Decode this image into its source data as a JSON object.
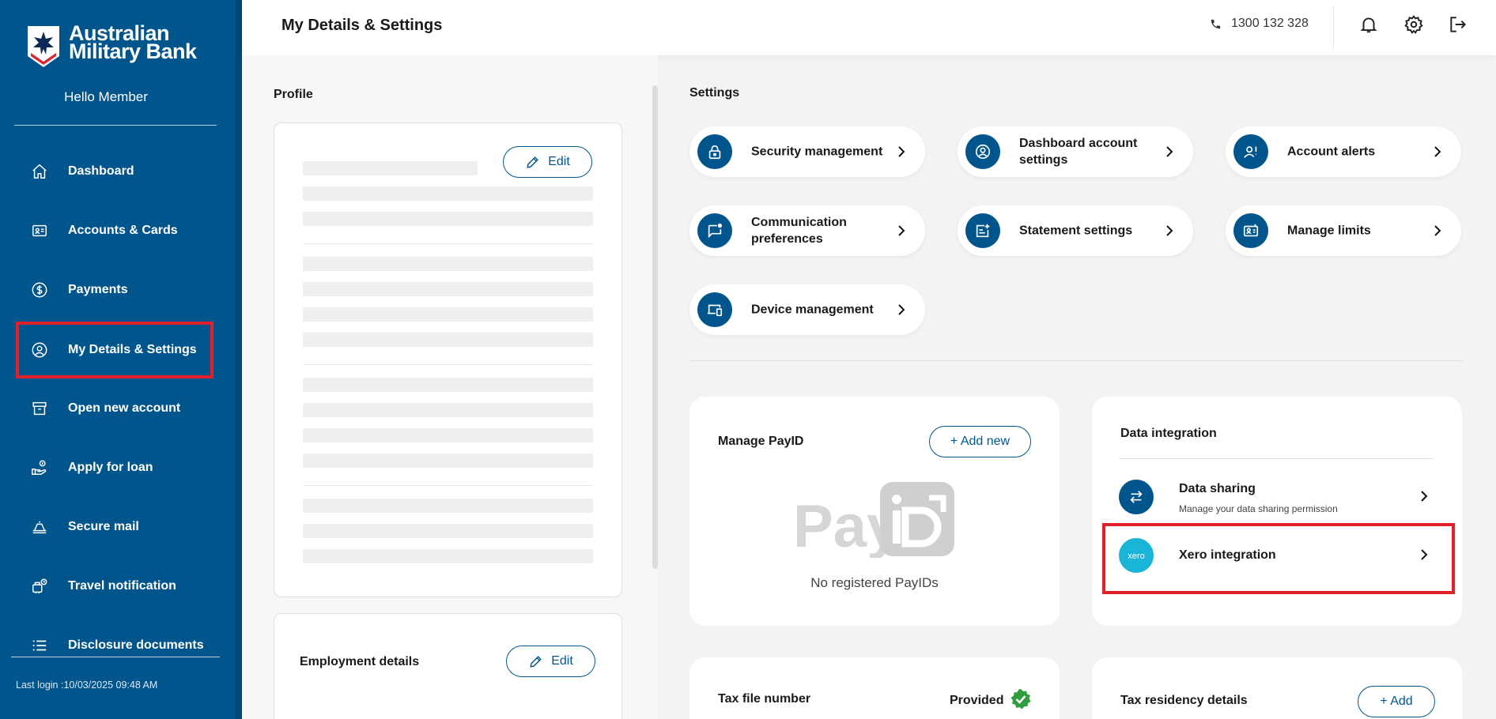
{
  "brand": {
    "name_line1": "Australian",
    "name_line2": "Military Bank",
    "greeting": "Hello Member"
  },
  "nav": {
    "items": [
      {
        "label": "Dashboard",
        "icon": "home-icon"
      },
      {
        "label": "Accounts & Cards",
        "icon": "card-icon"
      },
      {
        "label": "Payments",
        "icon": "dollar-circle-icon"
      },
      {
        "label": "My Details & Settings",
        "icon": "user-circle-icon",
        "highlighted": true
      },
      {
        "label": "Open new account",
        "icon": "archive-icon"
      },
      {
        "label": "Apply for loan",
        "icon": "loan-hand-icon"
      },
      {
        "label": "Secure mail",
        "icon": "inbox-icon"
      },
      {
        "label": "Travel notification",
        "icon": "travel-icon"
      },
      {
        "label": "Disclosure documents",
        "icon": "list-icon"
      }
    ],
    "last_login": "Last login :10/03/2025 09:48 AM"
  },
  "header": {
    "title": "My Details & Settings",
    "phone": "1300 132 328"
  },
  "profile": {
    "title": "Profile",
    "edit_label": "Edit",
    "employment_title": "Employment details",
    "employment_edit_label": "Edit"
  },
  "settings": {
    "title": "Settings",
    "tiles": [
      {
        "label": "Security management",
        "icon": "lock-icon"
      },
      {
        "label": "Dashboard account settings",
        "icon": "account-settings-icon"
      },
      {
        "label": "Account alerts",
        "icon": "alert-user-icon"
      },
      {
        "label": "Communication preferences",
        "icon": "chat-icon"
      },
      {
        "label": "Statement settings",
        "icon": "statement-icon"
      },
      {
        "label": "Manage limits",
        "icon": "limits-icon"
      },
      {
        "label": "Device management",
        "icon": "devices-icon"
      }
    ]
  },
  "payid": {
    "title": "Manage PayID",
    "add_label": "+ Add new",
    "logo_text": "PayID",
    "empty_text": "No registered PayIDs"
  },
  "data_integration": {
    "title": "Data integration",
    "data_sharing": {
      "title": "Data sharing",
      "subtitle": "Manage your data sharing permission"
    },
    "xero": {
      "title": "Xero integration",
      "logo_text": "xero"
    }
  },
  "tax": {
    "tfn_title": "Tax file number",
    "tfn_status": "Provided",
    "residency_title": "Tax residency details",
    "residency_add_label": "+ Add"
  },
  "colors": {
    "primary": "#00558c",
    "highlight": "#e0202a",
    "xero": "#1ab4d7",
    "success": "#2e9e3e"
  }
}
